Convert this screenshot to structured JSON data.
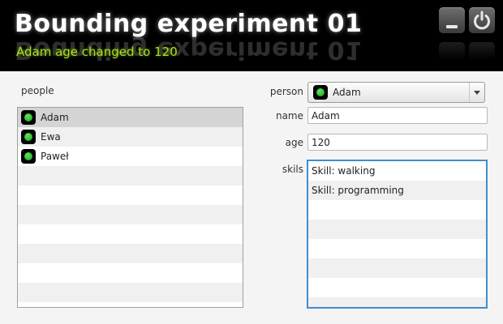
{
  "window": {
    "title": "Bounding experiment 01",
    "status_message": "Adam age changed to 120",
    "minimize_icon": "minimize-icon",
    "close_icon": "power-icon"
  },
  "people_pane": {
    "label": "people",
    "items": [
      {
        "name": "Adam",
        "icon": "green-status-icon",
        "selected": true
      },
      {
        "name": "Ewa",
        "icon": "green-status-icon",
        "selected": false
      },
      {
        "name": "Paweł",
        "icon": "green-status-icon",
        "selected": false
      }
    ]
  },
  "detail_form": {
    "person_label": "person",
    "person_selected": "Adam",
    "name_label": "name",
    "name_value": "Adam",
    "age_label": "age",
    "age_value": "120",
    "skills_label": "skils",
    "skills": [
      "Skill: walking",
      "Skill: programming"
    ]
  },
  "colors": {
    "header_bg": "#000000",
    "status_text": "#a8e01c",
    "focus_border": "#3d8fd0",
    "status_dot": "#22b022"
  }
}
